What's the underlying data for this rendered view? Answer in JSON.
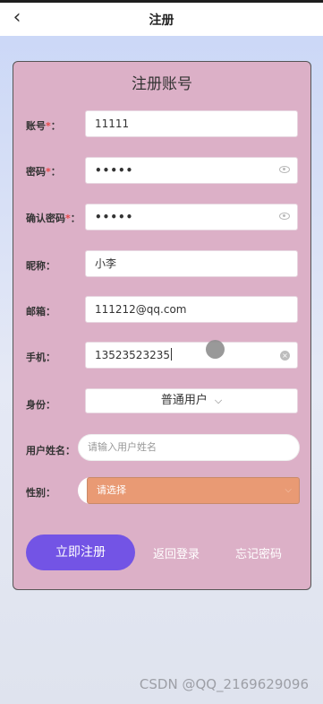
{
  "header": {
    "back_icon": "chevron-left-icon",
    "title": "注册"
  },
  "form": {
    "title": "注册账号",
    "account": {
      "label": "账号",
      "required": "*",
      "colon": "：",
      "value": "11111"
    },
    "password": {
      "label": "密码",
      "required": "*",
      "colon": "：",
      "value": "•••••"
    },
    "confirm_password": {
      "label": "确认密码",
      "required": "*",
      "colon": "：",
      "value": "•••••"
    },
    "nickname": {
      "label": "昵称：",
      "value": "小李"
    },
    "email": {
      "label": "邮箱：",
      "value": "111212@qq.com"
    },
    "phone": {
      "label": "手机：",
      "value": "13523523235"
    },
    "identity": {
      "label": "身份：",
      "value": "普通用户",
      "chevron": "⌵"
    },
    "user_name": {
      "label": "用户姓名：",
      "placeholder": "请输入用户姓名"
    },
    "gender": {
      "label": "性别：",
      "placeholder": "请选择",
      "chevron": "⌵"
    }
  },
  "actions": {
    "register": "立即注册",
    "back_to_login": "返回登录",
    "forgot_password": "忘记密码"
  },
  "watermark": "CSDN @QQ_2169629096",
  "colors": {
    "card": "#dcb0c7",
    "register_button": "#7354e5",
    "gender_select": "#e99a74",
    "required": "#e54848"
  }
}
